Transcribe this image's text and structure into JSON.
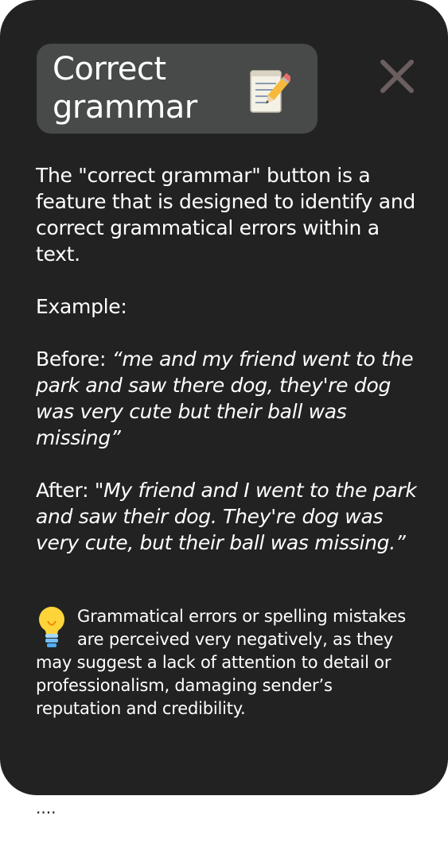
{
  "header": {
    "title": "Correct grammar",
    "title_icon": "memo-icon",
    "close_icon": "close-x-icon"
  },
  "content": {
    "description": "The \"correct grammar\" button is a feature that is designed to identify and correct grammatical errors within a text.",
    "example_label": "Example:",
    "before_label": "Before:",
    "before_text": "“me and my friend went to the park and saw there dog, they're dog was very cute but their ball was missing”",
    "after_label": "After:",
    "after_text": "\"My friend and I went to the park and saw their dog. They're dog was very cute, but their ball was missing.”",
    "tip_icon": "lightbulb-icon",
    "tip_text": "Grammatical errors or spelling mistakes are perceived very negatively, as they may suggest a lack of attention to detail or professionalism, damaging sender’s reputation and credibility."
  },
  "footer": {
    "ellipsis": "...."
  },
  "colors": {
    "card_bg": "#222222",
    "pill_bg": "#484a49",
    "close_icon": "#6b5e5e",
    "text": "#ffffff"
  }
}
